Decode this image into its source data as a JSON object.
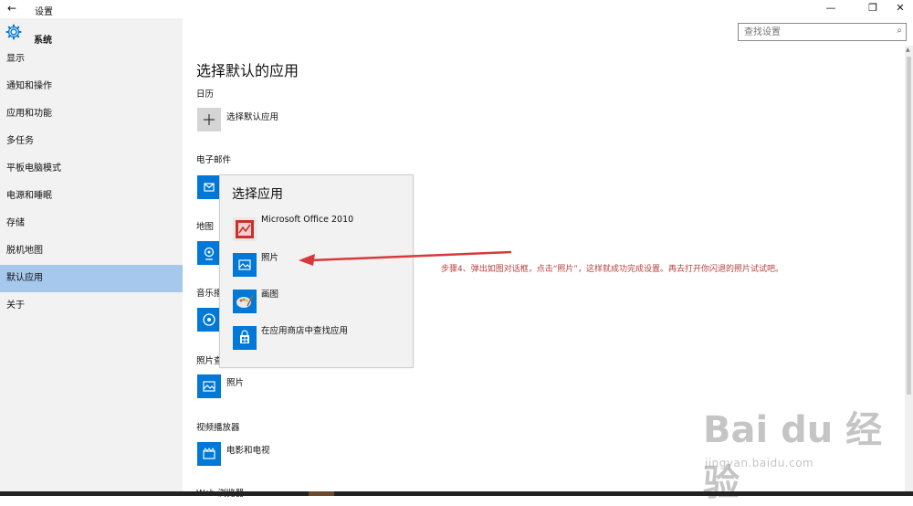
{
  "window": {
    "back_glyph": "←",
    "title": "设置",
    "minimize_glyph": "—",
    "restore_glyph": "❐",
    "close_glyph": "✕"
  },
  "sidebar": {
    "section_title": "系统",
    "gear_icon": "gear-icon",
    "items": [
      {
        "label": "显示"
      },
      {
        "label": "通知和操作"
      },
      {
        "label": "应用和功能"
      },
      {
        "label": "多任务"
      },
      {
        "label": "平板电脑模式"
      },
      {
        "label": "电源和睡眠"
      },
      {
        "label": "存储"
      },
      {
        "label": "脱机地图"
      },
      {
        "label": "默认应用",
        "active": true
      },
      {
        "label": "关于"
      }
    ]
  },
  "search": {
    "placeholder": "查找设置",
    "icon": "search-icon"
  },
  "main": {
    "title": "选择默认的应用",
    "sections": [
      {
        "label": "日历",
        "app": "选择默认应用",
        "icon": "plus-icon"
      },
      {
        "label": "电子邮件",
        "app": "",
        "icon": "mail-icon"
      },
      {
        "label": "地图",
        "app": "",
        "icon": "maps-icon"
      },
      {
        "label": "音乐播",
        "app": "",
        "icon": "music-icon"
      },
      {
        "label": "照片查",
        "app": "照片",
        "icon": "photos-icon"
      },
      {
        "label": "视频播放器",
        "app": "电影和电视",
        "icon": "video-icon"
      },
      {
        "label": "Web 浏览器",
        "app": "",
        "icon": ""
      }
    ]
  },
  "popup": {
    "title": "选择应用",
    "items": [
      {
        "label": "Microsoft Office 2010",
        "icon": "office-icon"
      },
      {
        "label": "照片",
        "icon": "photos-icon"
      },
      {
        "label": "画图",
        "icon": "paint-icon"
      },
      {
        "label": "在应用商店中查找应用",
        "icon": "store-icon"
      }
    ]
  },
  "annotation": {
    "text": "步骤4、弹出如图对话框，点击“照片”，这样就成功完成设置。再去打开你闪退的照片试试吧。",
    "color": "#b5413e"
  },
  "watermark": {
    "brand": "Bai du 经验",
    "url": "jingyan.baidu.com"
  },
  "colors": {
    "accent": "#0078d7",
    "sidebar_bg": "#f2f2f2",
    "active_item": "#a6c8ec"
  }
}
